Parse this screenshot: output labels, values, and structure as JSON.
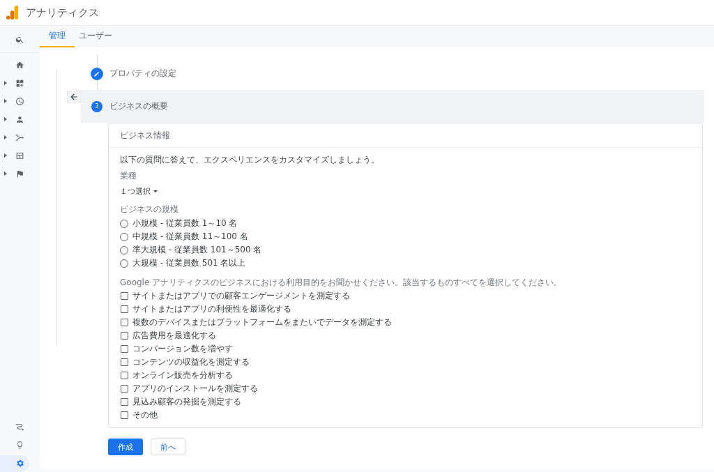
{
  "header": {
    "title": "アナリティクス"
  },
  "sidebar": {
    "top": [
      {
        "expandable": false
      },
      {
        "expandable": false
      },
      {
        "expandable": true
      },
      {
        "expandable": true
      },
      {
        "expandable": true
      },
      {
        "expandable": true
      },
      {
        "expandable": true
      },
      {
        "expandable": true
      }
    ],
    "bottom": [
      {
        "selected": false
      },
      {
        "selected": false
      },
      {
        "selected": true
      }
    ]
  },
  "tabs": [
    {
      "label": "管理",
      "selected": true
    },
    {
      "label": "ユーザー",
      "selected": false
    }
  ],
  "steps": [
    {
      "kind": "edit",
      "label": "プロパティの設定",
      "selected": false
    },
    {
      "kind": "number",
      "number": "3",
      "label": "ビジネスの概要",
      "selected": true
    }
  ],
  "card": {
    "title": "ビジネス情報",
    "intro": "以下の質問に答えて、エクスペリエンスをカスタマイズしましょう。",
    "industry": {
      "label": "業種",
      "value": "１つ選択"
    },
    "size": {
      "label": "ビジネスの規模",
      "options": [
        {
          "label": "小規模 - 従業員数 1～10 名",
          "selected": false
        },
        {
          "label": "中規模 - 従業員数 11～100 名",
          "selected": false
        },
        {
          "label": "準大規模 - 従業員数 101～500 名",
          "selected": false
        },
        {
          "label": "大規模 - 従業員数 501 名以上",
          "selected": false
        }
      ]
    },
    "purpose": {
      "label": "Google アナリティクスのビジネスにおける利用目的をお聞かせください。該当するものすべてを選択してください。",
      "options": [
        {
          "label": "サイトまたはアプリでの顧客エンゲージメントを測定する",
          "checked": false
        },
        {
          "label": "サイトまたはアプリの利便性を最適化する",
          "checked": false
        },
        {
          "label": "複数のデバイスまたはプラットフォームをまたいでデータを測定する",
          "checked": false
        },
        {
          "label": "広告費用を最適化する",
          "checked": false
        },
        {
          "label": "コンバージョン数を増やす",
          "checked": false
        },
        {
          "label": "コンテンツの収益化を測定する",
          "checked": false
        },
        {
          "label": "オンライン販売を分析する",
          "checked": false
        },
        {
          "label": "アプリのインストールを測定する",
          "checked": false
        },
        {
          "label": "見込み顧客の発掘を測定する",
          "checked": false
        },
        {
          "label": "その他",
          "checked": false
        }
      ]
    }
  },
  "buttons": [
    {
      "kind": "primary",
      "label": "作成"
    },
    {
      "kind": "secondary",
      "label": "前へ"
    }
  ]
}
